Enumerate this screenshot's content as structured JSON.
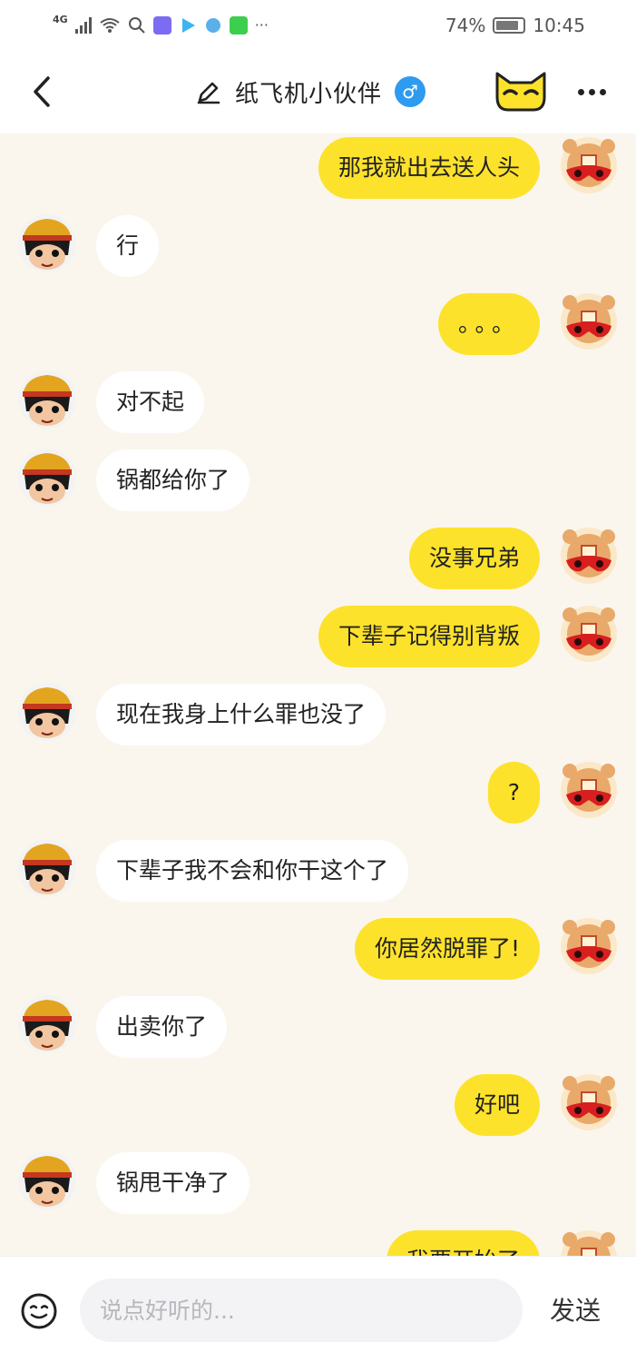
{
  "status_bar": {
    "network": "4G",
    "battery_percent": "74%",
    "time": "10:45",
    "more_indicator": "···"
  },
  "header": {
    "title": "纸飞机小伙伴",
    "gender_symbol": "♂",
    "back_icon": "chevron-left-icon",
    "edit_icon": "pencil-icon",
    "mask_icon": "cat-mask-icon",
    "more_icon": "more-dots-icon"
  },
  "colors": {
    "outgoing_bubble": "#fde22b",
    "incoming_bubble": "#ffffff",
    "background": "#faf6ee",
    "gender_badge": "#2e9bf0"
  },
  "messages": [
    {
      "side": "out",
      "text": "那我就出去送人头"
    },
    {
      "side": "in",
      "text": "行"
    },
    {
      "side": "out",
      "text": "。。。"
    },
    {
      "side": "in",
      "text": "对不起"
    },
    {
      "side": "in",
      "text": "锅都给你了"
    },
    {
      "side": "out",
      "text": "没事兄弟"
    },
    {
      "side": "out",
      "text": "下辈子记得别背叛"
    },
    {
      "side": "in",
      "text": "现在我身上什么罪也没了"
    },
    {
      "side": "out",
      "text": "?"
    },
    {
      "side": "in",
      "text": "下辈子我不会和你干这个了"
    },
    {
      "side": "out",
      "text": "你居然脱罪了!"
    },
    {
      "side": "in",
      "text": "出卖你了"
    },
    {
      "side": "out",
      "text": "好吧"
    },
    {
      "side": "in",
      "text": "锅甩干净了"
    },
    {
      "side": "out",
      "text": "我要开始了"
    }
  ],
  "input": {
    "placeholder": "说点好听的...",
    "value": "",
    "send_label": "发送",
    "emoji_icon": "smiley-icon"
  }
}
